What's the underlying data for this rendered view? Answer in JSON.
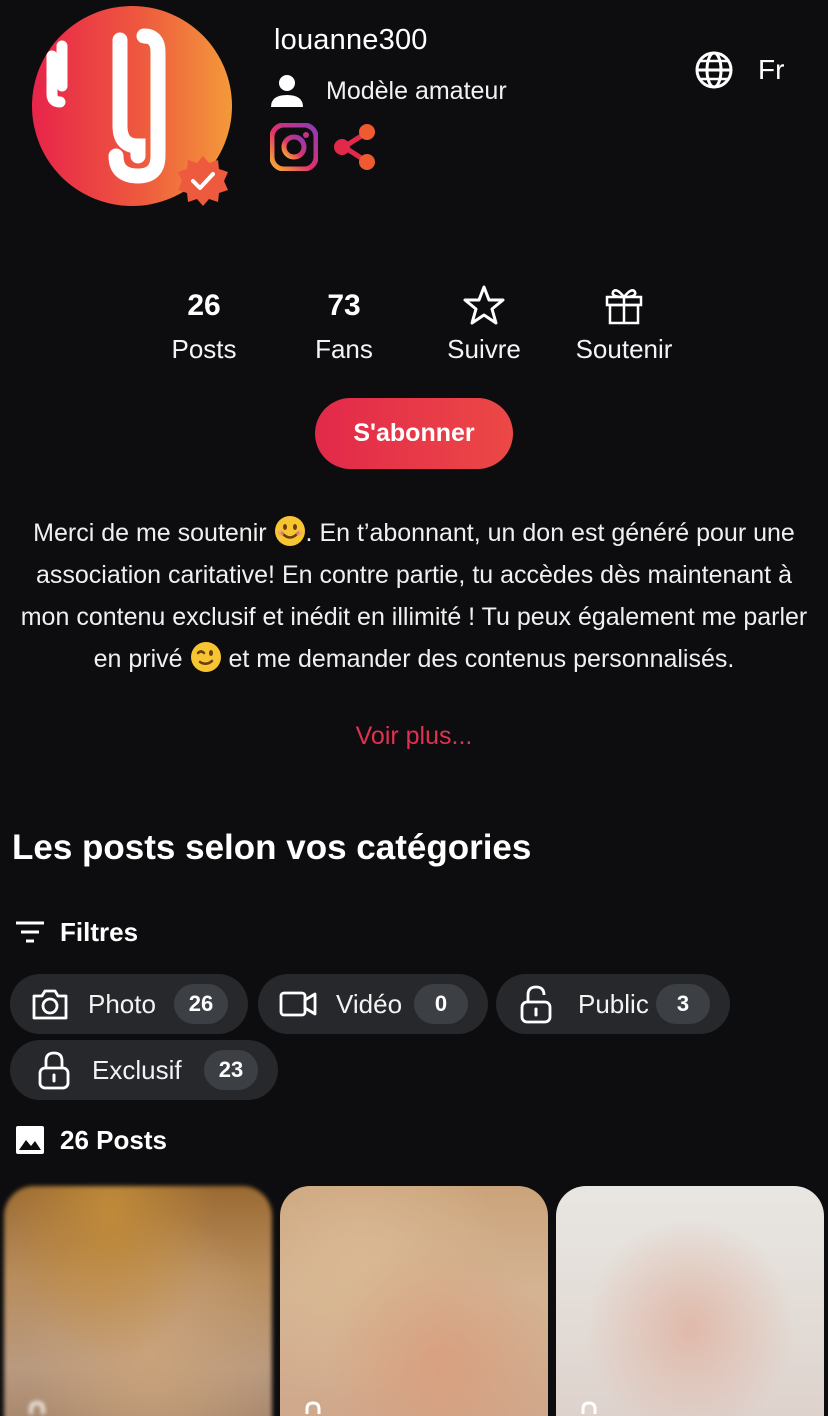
{
  "profile": {
    "username": "louanne300",
    "role": "Modèle amateur",
    "language": "Fr"
  },
  "stats": {
    "posts_count": "26",
    "posts_label": "Posts",
    "fans_count": "73",
    "fans_label": "Fans",
    "follow_label": "Suivre",
    "support_label": "Soutenir"
  },
  "subscribe_label": "S'abonner",
  "bio": {
    "part1": "Merci de me soutenir ",
    "part2": ". En t’abonnant, un don est généré pour une association caritative! En contre partie, tu accèdes dès maintenant à mon contenu exclusif et inédit en illimité ! Tu peux également me parler en privé ",
    "part3": " et me demander des contenus personnalisés.",
    "more_label": "Voir plus..."
  },
  "section_title": "Les posts selon vos catégories",
  "filters_label": "Filtres",
  "chips": [
    {
      "label": "Photo",
      "count": "26",
      "icon": "camera-icon"
    },
    {
      "label": "Vidéo",
      "count": "0",
      "icon": "video-icon"
    },
    {
      "label": "Public",
      "count": "3",
      "icon": "unlock-icon"
    },
    {
      "label": "Exclusif",
      "count": "23",
      "icon": "lock-icon"
    }
  ],
  "posts_total_label": "26 Posts",
  "colors": {
    "background": "#0d0d0f",
    "accent": "#e2294a",
    "chip_bg": "#26282c",
    "link": "#e0314f"
  }
}
